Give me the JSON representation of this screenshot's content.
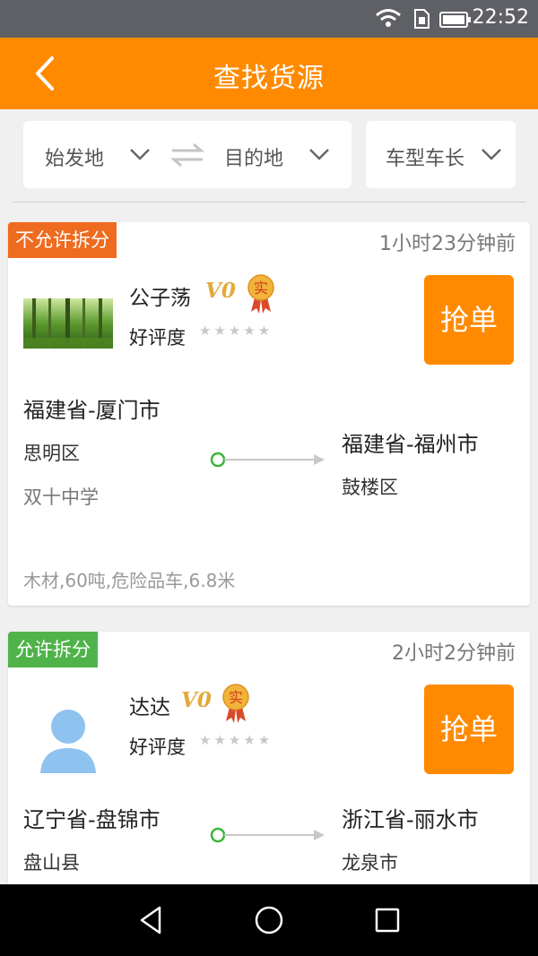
{
  "status_bar": {
    "time": "22:52"
  },
  "header": {
    "title": "查找货源"
  },
  "filters": {
    "origin_label": "始发地",
    "destination_label": "目的地",
    "vehicle_label": "车型车长"
  },
  "listings": [
    {
      "split_tag": "不允许拆分",
      "posted": "1小时23分钟前",
      "name": "公子荡",
      "level": "V0",
      "verified_badge": "实",
      "rating_label": "好评度",
      "rating_stars": 0,
      "grab_label": "抢单",
      "from_city": "福建省-厦门市",
      "from_district": "思明区",
      "from_address": "双十中学",
      "to_city": "福建省-福州市",
      "to_district": "鼓楼区",
      "cargo": "木材,60吨,危险品车,6.8米"
    },
    {
      "split_tag": "允许拆分",
      "posted": "2小时2分钟前",
      "name": "达达",
      "level": "V0",
      "verified_badge": "实",
      "rating_label": "好评度",
      "rating_stars": 0,
      "grab_label": "抢单",
      "from_city": "辽宁省-盘锦市",
      "from_district": "盘山县",
      "to_city": "浙江省-丽水市",
      "to_district": "龙泉市"
    }
  ],
  "colors": {
    "accent": "#ff8a00",
    "tag_not_allowed": "#ee6b1f",
    "tag_allowed": "#4fb34a",
    "route_dot": "#3ab53a"
  }
}
